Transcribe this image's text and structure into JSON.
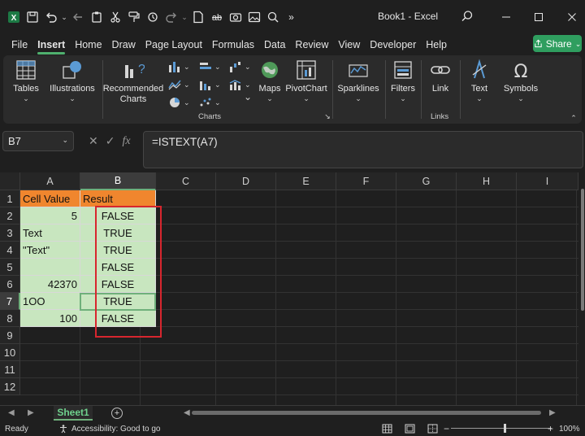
{
  "window": {
    "title": "Book1  -  Excel",
    "accent": "#2f9e5f"
  },
  "quick_access": {
    "icons": [
      "excel-logo-icon",
      "save-icon",
      "undo-icon",
      "undo-dropdown-icon",
      "redo-icon",
      "paste-icon",
      "cut-icon",
      "format-painter-icon",
      "copy-icon",
      "redo2-icon",
      "new-doc-icon",
      "strikethrough-icon",
      "camera-icon",
      "image-icon",
      "zoom-icon",
      "more-icon"
    ]
  },
  "menu": {
    "tabs": [
      "File",
      "Insert",
      "Home",
      "Draw",
      "Page Layout",
      "Formulas",
      "Data",
      "Review",
      "View",
      "Developer",
      "Help"
    ],
    "active": "Insert",
    "share_label": "Share"
  },
  "ribbon": {
    "tables": "Tables",
    "illustrations": "Illustrations",
    "recommended_charts_l1": "Recommended",
    "recommended_charts_l2": "Charts",
    "charts_group": "Charts",
    "maps": "Maps",
    "pivotchart": "PivotChart",
    "sparklines": "Sparklines",
    "filters": "Filters",
    "link": "Link",
    "links_group": "Links",
    "text": "Text",
    "symbols": "Symbols"
  },
  "formula_bar": {
    "name_box": "B7",
    "formula": "=ISTEXT(A7)"
  },
  "sheet": {
    "columns": [
      "A",
      "B",
      "C",
      "D",
      "E",
      "F",
      "G",
      "H",
      "I"
    ],
    "selected_column": "B",
    "rows": [
      "1",
      "2",
      "3",
      "4",
      "5",
      "6",
      "7",
      "8",
      "9",
      "10",
      "11",
      "12"
    ],
    "selected_row": "7",
    "header": {
      "a": "Cell Value",
      "b": "Result"
    },
    "data": [
      {
        "a": "5",
        "b": "FALSE",
        "a_align": "num"
      },
      {
        "a": "Text",
        "b": "TRUE",
        "a_align": "txt"
      },
      {
        "a": "\"Text\"",
        "b": "TRUE",
        "a_align": "txt"
      },
      {
        "a": "",
        "b": "FALSE",
        "a_align": "txt"
      },
      {
        "a": "42370",
        "b": "FALSE",
        "a_align": "num"
      },
      {
        "a": "1OO",
        "b": "TRUE",
        "a_align": "txt"
      },
      {
        "a": "100",
        "b": "FALSE",
        "a_align": "num"
      }
    ],
    "colors": {
      "header": "#f0862e",
      "data": "#c8e6bf",
      "highlight_box": "#d7262e"
    }
  },
  "sheet_tabs": {
    "tabs": [
      "Sheet1"
    ],
    "active": "Sheet1"
  },
  "status": {
    "ready": "Ready",
    "accessibility": "Accessibility: Good to go",
    "zoom": "100%"
  }
}
